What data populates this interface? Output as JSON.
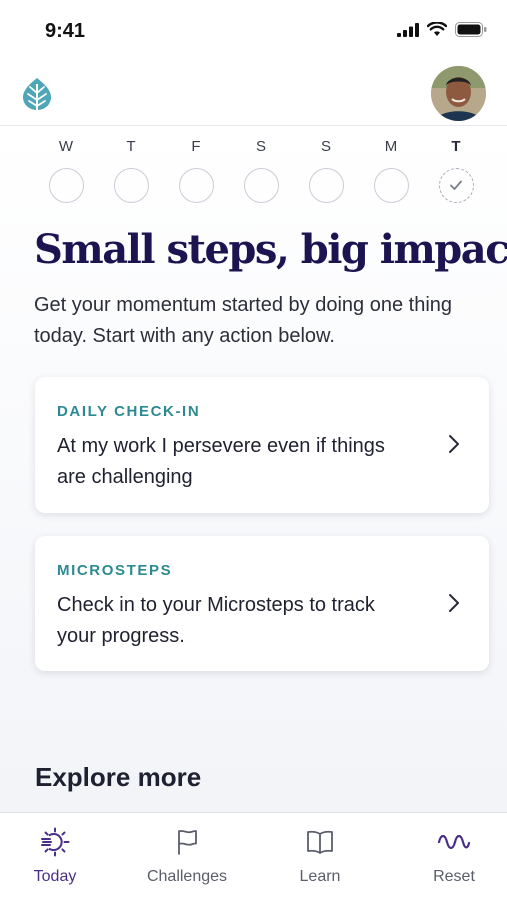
{
  "status_bar": {
    "time": "9:41",
    "icons": [
      "cellular-signal-icon",
      "wifi-icon",
      "battery-icon"
    ]
  },
  "header": {
    "logo": "leaf-logo-icon",
    "avatar": "user-avatar"
  },
  "week": {
    "days": [
      {
        "letter": "W",
        "checked": false,
        "today": false
      },
      {
        "letter": "T",
        "checked": false,
        "today": false
      },
      {
        "letter": "F",
        "checked": false,
        "today": false
      },
      {
        "letter": "S",
        "checked": false,
        "today": false
      },
      {
        "letter": "S",
        "checked": false,
        "today": false
      },
      {
        "letter": "M",
        "checked": false,
        "today": false
      },
      {
        "letter": "T",
        "checked": true,
        "today": true
      }
    ]
  },
  "main": {
    "headline": "Small steps, big impact",
    "subtext": "Get your momentum started by doing one thing today. Start with any action below."
  },
  "cards": [
    {
      "eyebrow": "DAILY CHECK-IN",
      "text": "At my work I persevere even if things are challenging",
      "icon": "chevron-right-icon"
    },
    {
      "eyebrow": "MICROSTEPS",
      "text": "Check in to your Microsteps to track your progress.",
      "icon": "chevron-right-icon"
    }
  ],
  "explore": {
    "title": "Explore more"
  },
  "tabbar": {
    "items": [
      {
        "label": "Today",
        "icon": "sun-icon",
        "active": true
      },
      {
        "label": "Challenges",
        "icon": "flag-icon",
        "active": false
      },
      {
        "label": "Learn",
        "icon": "book-icon",
        "active": false
      },
      {
        "label": "Reset",
        "icon": "wave-icon",
        "active": false
      }
    ]
  },
  "colors": {
    "accent_purple": "#4a2f88",
    "headline_navy": "#1c1450",
    "eyebrow_teal": "#2e8a92",
    "logo_teal": "#4fa6b8"
  }
}
